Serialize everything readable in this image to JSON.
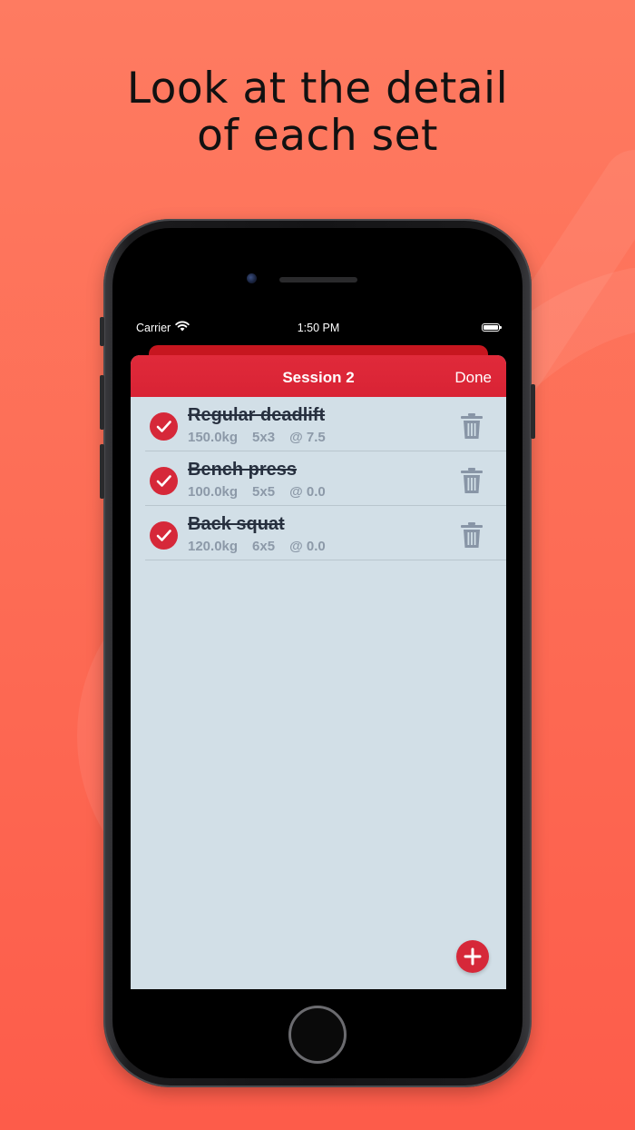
{
  "headline": {
    "line1": "Look at the detail",
    "line2": "of each set"
  },
  "status_bar": {
    "carrier": "Carrier",
    "time": "1:50 PM"
  },
  "navbar": {
    "title": "Session 2",
    "done_label": "Done"
  },
  "exercises": [
    {
      "name": "Regular deadlift",
      "weight": "150.0kg",
      "sets_reps": "5x3",
      "rpe": "@ 7.5",
      "completed": true
    },
    {
      "name": "Bench press",
      "weight": "100.0kg",
      "sets_reps": "5x5",
      "rpe": "@ 0.0",
      "completed": true
    },
    {
      "name": "Back squat",
      "weight": "120.0kg",
      "sets_reps": "6x5",
      "rpe": "@ 0.0",
      "completed": true
    }
  ],
  "colors": {
    "accent": "#d62839",
    "sheet_background": "#d2dfe7",
    "page_background": "#fd6c55"
  },
  "icons": {
    "check": "checkmark-circle-icon",
    "delete": "trash-icon",
    "add": "plus-icon"
  }
}
